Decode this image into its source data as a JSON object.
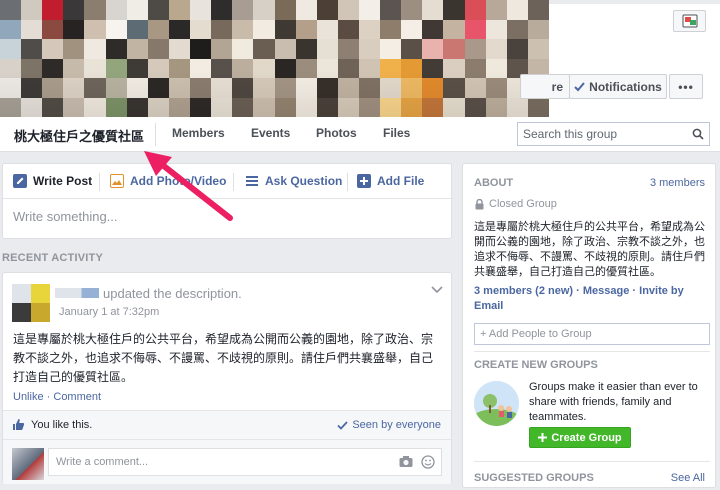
{
  "cover": {
    "mosaic_colors": [
      "#6b6e73",
      "#cfc9bf",
      "#c21d2e",
      "#3a3838",
      "#8c7e6e",
      "#d8d4cf",
      "#f0ece6",
      "#4e4a46",
      "#b9a78e",
      "#e8e3dc",
      "#2f2d2c",
      "#a79d92",
      "#d7d0c7",
      "#7a6a58",
      "#efe9e1",
      "#4b3f36",
      "#d1c5b7",
      "#f3efe8",
      "#5c5450",
      "#9c8e80",
      "#e6ddd2",
      "#3b3530",
      "#d94e57",
      "#b7a89a",
      "#efe8de",
      "#6d6259",
      "#91a7bb",
      "#e3ddd5",
      "#8a4a3f",
      "#262322",
      "#cfbfae",
      "#f7f3ee",
      "#5d6b75",
      "#a89883",
      "#2b2927",
      "#e4dccf",
      "#77695c",
      "#c9bba9",
      "#f1ebe2",
      "#3f3934",
      "#b4a08a",
      "#eae3d9",
      "#5a4c41",
      "#dcd1c3",
      "#8e7d6b",
      "#f4eee6",
      "#403834",
      "#c5b3a1",
      "#e8556a",
      "#ede6dc",
      "#7b6f63",
      "#b9ab9c",
      "#c7d2d9",
      "#4f4c49",
      "#d3c8ba",
      "#a0927f",
      "#efe9e1",
      "#2f2b29",
      "#c1b4a3",
      "#86786a",
      "#e3dbd0",
      "#1f1d1c",
      "#b3a593",
      "#f0eadf",
      "#6a5d51",
      "#c9bdaf",
      "#3a342f",
      "#e6dfd4",
      "#8d7f71",
      "#d8cdbf",
      "#f4eee5",
      "#5b5048",
      "#e9b2ad",
      "#c97770",
      "#a9998a",
      "#e3dacd",
      "#4a423c",
      "#ccc0b1",
      "#d7d1c9",
      "#7d7467",
      "#2e2a27",
      "#c6baab",
      "#e9e2d7",
      "#93a57d",
      "#3e3a36",
      "#d4c9ba",
      "#a5977f",
      "#f2ece3",
      "#58504a",
      "#bcae9d",
      "#e1d8ca",
      "#2a2624",
      "#9b8d7d",
      "#ece5da",
      "#6f6357",
      "#d0c3b3",
      "#f0b04a",
      "#e49a34",
      "#433b35",
      "#d9cebf",
      "#8b7c6d",
      "#efe8dd",
      "#5e544c",
      "#c4b6a6",
      "#edeae5",
      "#3d3a37",
      "#a99c8b",
      "#dcd2c5",
      "#6e655b",
      "#b7b2a0",
      "#f1ebe3",
      "#2c2826",
      "#cbbfae",
      "#8a7d6f",
      "#e7dfd3",
      "#4f4740",
      "#d5c9b9",
      "#a39484",
      "#f3ede4",
      "#372f2a",
      "#c0b2a1",
      "#7f7264",
      "#e2d8ca",
      "#edb862",
      "#e28a2d",
      "#5b5047",
      "#d1c4b4",
      "#9a8b7b",
      "#ede5d9",
      "#463e38",
      "#a7a096",
      "#e6e1da",
      "#524c46",
      "#c8bcae",
      "#f0e9df",
      "#7d9367",
      "#3a3531",
      "#dbd1c4",
      "#b0a190",
      "#2e2a27",
      "#e9e1d5",
      "#6b5f54",
      "#cdbfaf",
      "#93846f",
      "#f2ebe1",
      "#4a413a",
      "#d6cab9",
      "#a09080",
      "#f9d58c",
      "#e6a444",
      "#c3763a",
      "#e7dece",
      "#5a5049",
      "#bdae9c",
      "#eae2d6",
      "#7a6d60"
    ]
  },
  "header": {
    "share_label": "re",
    "notifications_label": "Notifications",
    "more_label": "•••"
  },
  "tabbar": {
    "group_name": "桃大極住戶之優質社區",
    "tabs": [
      "Members",
      "Events",
      "Photos",
      "Files"
    ],
    "search_placeholder": "Search this group"
  },
  "composer": {
    "tabs": [
      {
        "label": "Write Post"
      },
      {
        "label": "Add Photo/Video"
      },
      {
        "label": "Ask Question"
      },
      {
        "label": "Add File"
      }
    ],
    "placeholder": "Write something..."
  },
  "recent_activity": {
    "heading": "RECENT ACTIVITY",
    "action_text": "updated the description.",
    "date": "January 1 at 7:32pm",
    "post_text": "這是專屬於桃大極住戶的公共平台，希望成為公開而公義的園地，除了政治、宗教不談之外，也追求不侮辱、不謾罵、不歧視的原則。請住戶們共襄盛舉，自己打造自己的優質社區。",
    "unlike_label": "Unlike",
    "comment_label": "Comment",
    "separator": "·",
    "likes_text": "You like this.",
    "seen_text": "Seen by everyone",
    "comment_placeholder": "Write a comment..."
  },
  "about": {
    "title": "ABOUT",
    "members_count": "3 members",
    "privacy": "Closed Group",
    "description": "這是專屬於桃大極住戶的公共平台，希望成為公開而公義的園地，除了政治、宗教不談之外，也追求不侮辱、不謾罵、不歧視的原則。請住戶們共襄盛舉，自己打造自己的優質社區。",
    "members_link": "3 members",
    "new_count": "(2 new)",
    "message_link": "Message",
    "invite_link": "Invite by Email",
    "add_people_placeholder": "+ Add People to Group"
  },
  "create_groups": {
    "title": "CREATE NEW GROUPS",
    "text": "Groups make it easier than ever to share with friends, family and teammates.",
    "button_label": "Create Group"
  },
  "suggested": {
    "title": "SUGGESTED GROUPS",
    "see_all": "See All"
  },
  "colors": {
    "link": "#4b67a1",
    "green": "#42b72a",
    "arrow": "#ec1f62"
  }
}
